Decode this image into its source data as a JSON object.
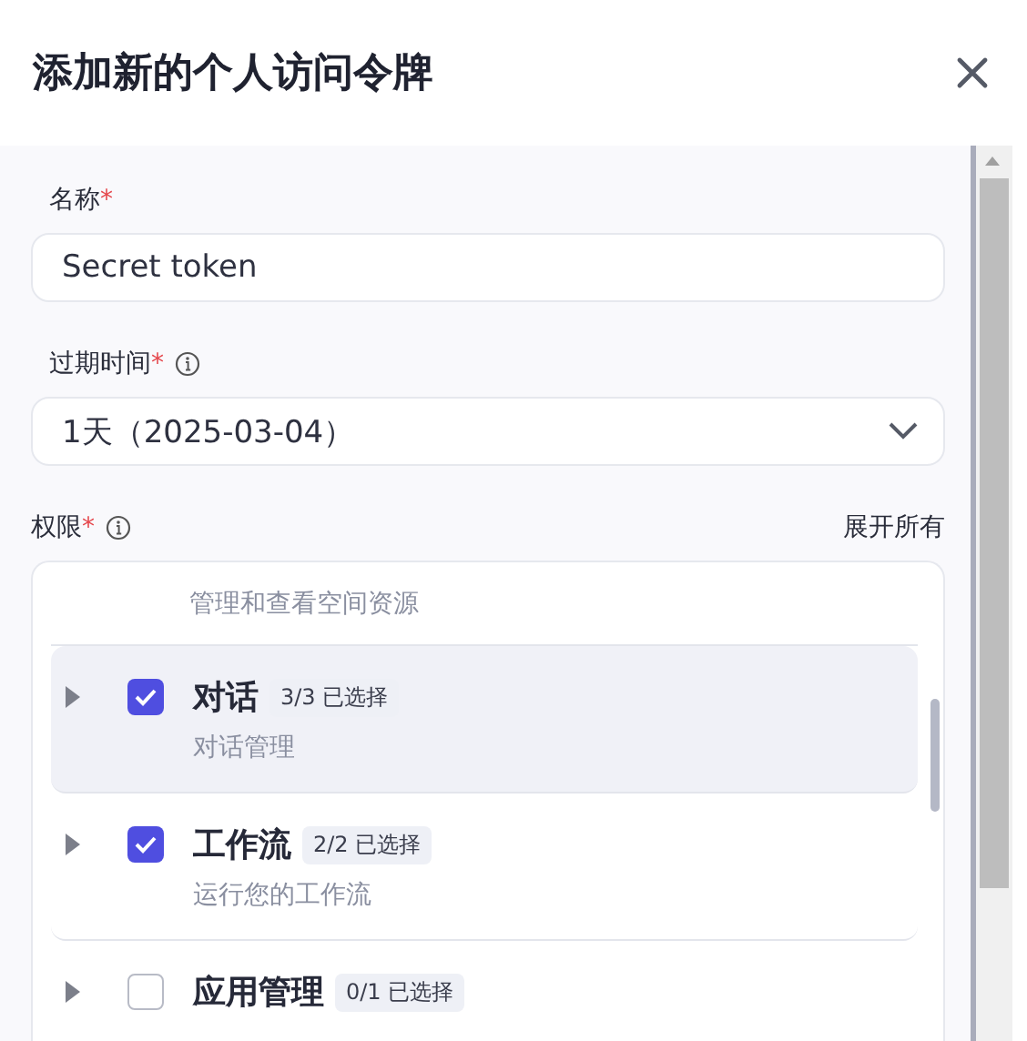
{
  "dialog": {
    "title": "添加新的个人访问令牌"
  },
  "fields": [
    {
      "kind": "text",
      "label": "名称",
      "required": "*",
      "info": false,
      "value": "Secret token"
    },
    {
      "kind": "select",
      "label": "过期时间",
      "required": "*",
      "info": true,
      "value": "1天（2025-03-04）"
    }
  ],
  "permissions": {
    "label": "权限",
    "required": "*",
    "info": true,
    "expand_all": "展开所有",
    "items": [
      {
        "kind": "tail",
        "description": "管理和查看空间资源"
      },
      {
        "kind": "full",
        "title": "对话",
        "badge": "3/3 已选择",
        "description": "对话管理",
        "checked": true,
        "selected": true
      },
      {
        "kind": "full",
        "title": "工作流",
        "badge": "2/2 已选择",
        "description": "运行您的工作流",
        "checked": true,
        "selected": false
      },
      {
        "kind": "full",
        "title": "应用管理",
        "badge": "0/1 已选择",
        "checked": false,
        "selected": false
      }
    ]
  }
}
